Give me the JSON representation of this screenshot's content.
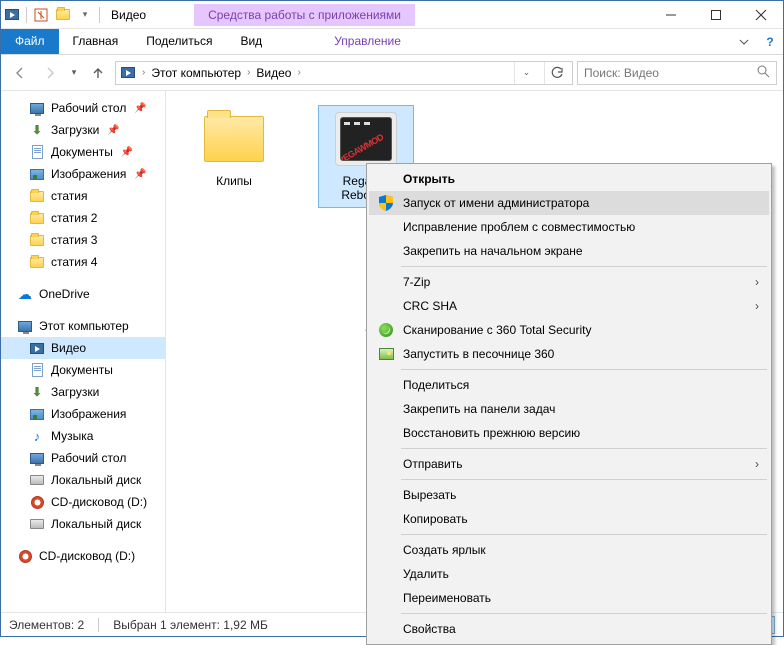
{
  "title": "Видео",
  "tool_tab": "Средства работы с приложениями",
  "ribbon": {
    "file": "Файл",
    "tabs": [
      "Главная",
      "Поделиться",
      "Вид"
    ],
    "tool": "Управление"
  },
  "breadcrumb": {
    "root": "Этот компьютер",
    "current": "Видео"
  },
  "search": {
    "placeholder": "Поиск: Видео"
  },
  "tree": {
    "quick": [
      {
        "label": "Рабочий стол",
        "icon": "monitor",
        "pinned": true
      },
      {
        "label": "Загрузки",
        "icon": "download",
        "pinned": true
      },
      {
        "label": "Документы",
        "icon": "doc",
        "pinned": true
      },
      {
        "label": "Изображения",
        "icon": "image",
        "pinned": true
      },
      {
        "label": "статия",
        "icon": "folder"
      },
      {
        "label": "статия 2",
        "icon": "folder"
      },
      {
        "label": "статия 3",
        "icon": "folder"
      },
      {
        "label": "статия 4",
        "icon": "folder"
      }
    ],
    "onedrive": "OneDrive",
    "thispc": {
      "label": "Этот компьютер",
      "children": [
        {
          "label": "Видео",
          "icon": "video",
          "selected": true
        },
        {
          "label": "Документы",
          "icon": "doc"
        },
        {
          "label": "Загрузки",
          "icon": "download"
        },
        {
          "label": "Изображения",
          "icon": "image"
        },
        {
          "label": "Музыка",
          "icon": "music"
        },
        {
          "label": "Рабочий стол",
          "icon": "monitor"
        },
        {
          "label": "Локальный диск",
          "icon": "drive"
        },
        {
          "label": "CD-дисковод (D:)",
          "icon": "cd"
        },
        {
          "label": "Локальный диск",
          "icon": "drive"
        }
      ]
    },
    "cd2": "CD-дисковод (D:)"
  },
  "items": {
    "folder": "Клипы",
    "exe": "Regawld Rebooter"
  },
  "ctx": {
    "open": "Открыть",
    "runas": "Запуск от имени администратора",
    "compat": "Исправление проблем с совместимостью",
    "pinstart": "Закрепить на начальном экране",
    "sevenzip": "7-Zip",
    "crc": "CRC SHA",
    "scan360": "Сканирование с 360 Total Security",
    "sandbox360": "Запустить в песочнице 360",
    "share": "Поделиться",
    "pintaskbar": "Закрепить на панели задач",
    "restore": "Восстановить прежнюю версию",
    "sendto": "Отправить",
    "cut": "Вырезать",
    "copy": "Копировать",
    "shortcut": "Создать ярлык",
    "delete": "Удалить",
    "rename": "Переименовать",
    "props": "Свойства"
  },
  "status": {
    "count_label": "Элементов: 2",
    "selection_label": "Выбран 1 элемент: 1,92 МБ"
  }
}
